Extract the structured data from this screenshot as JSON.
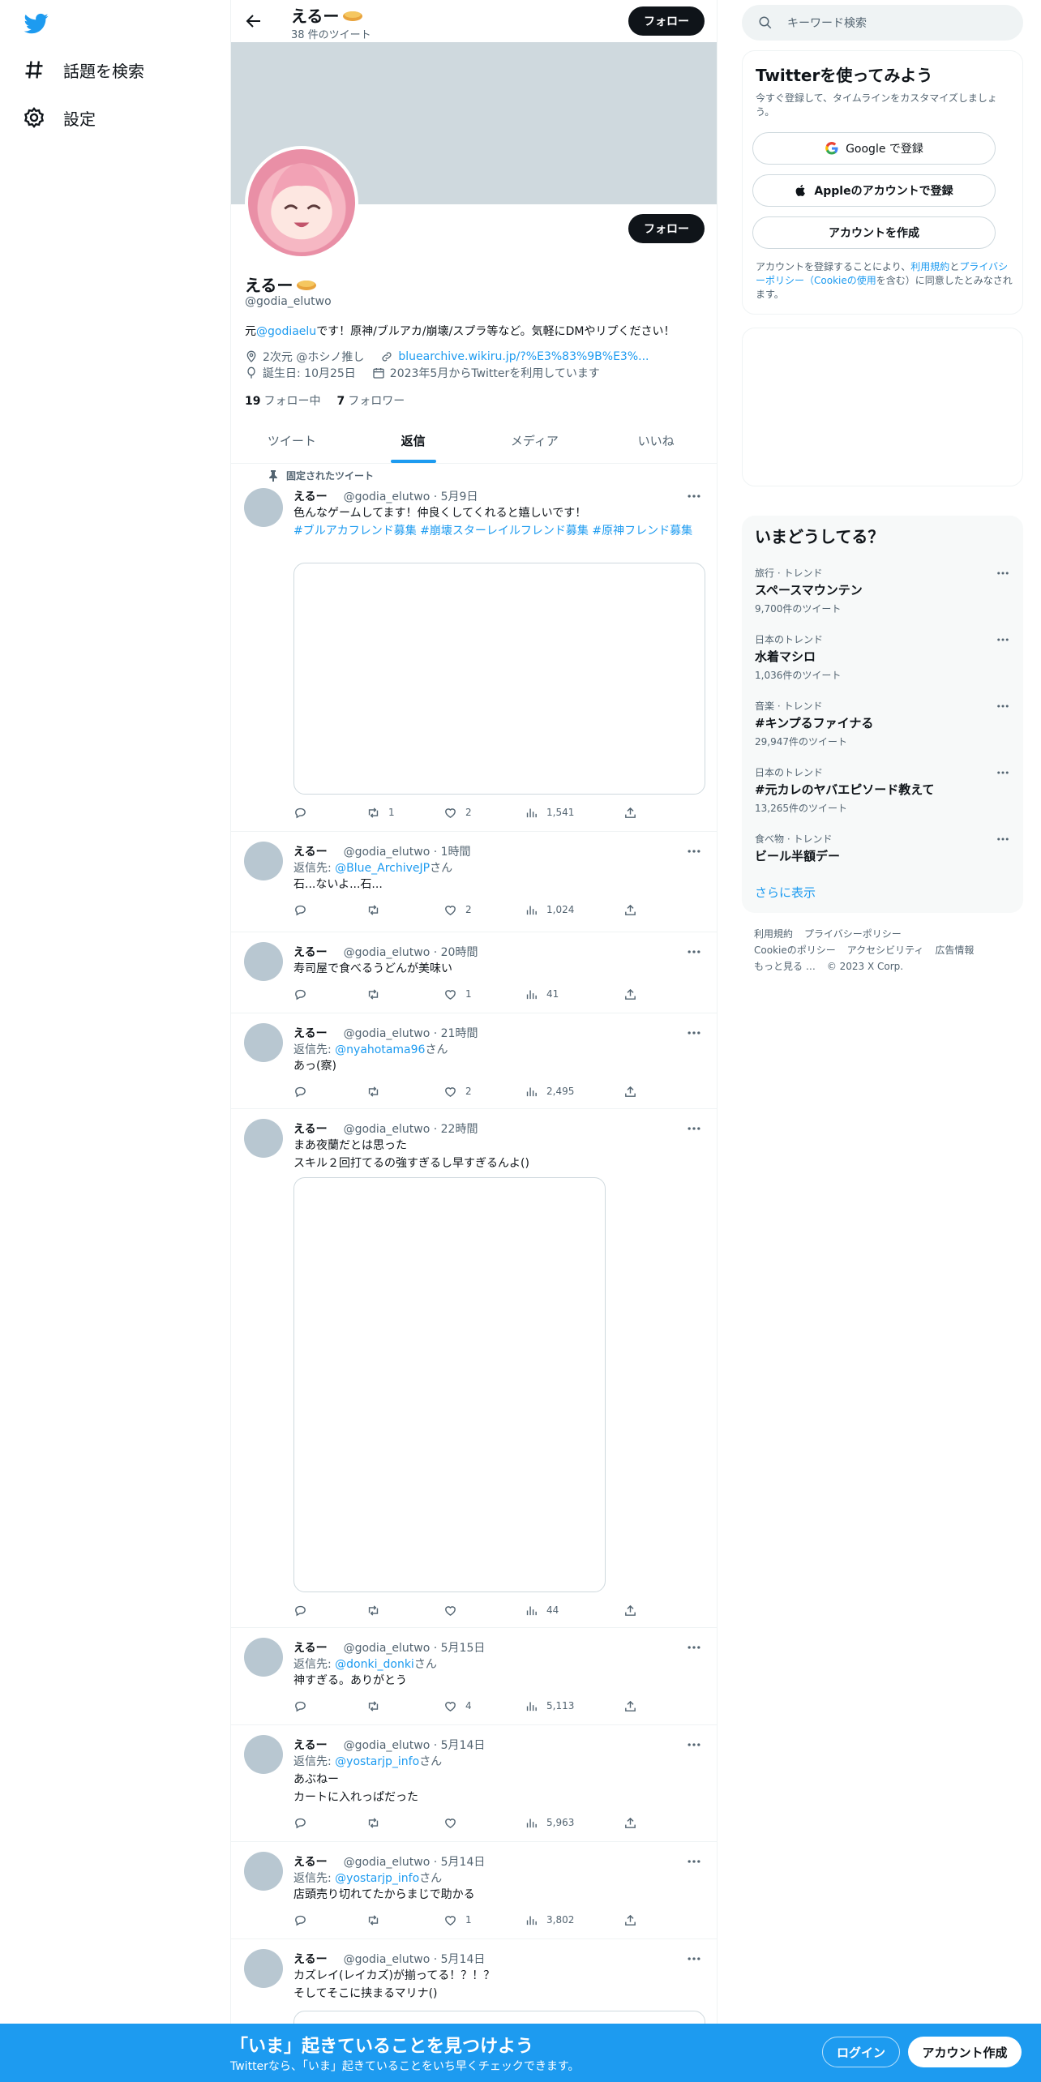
{
  "nav": {
    "explore_label": "話題を検索",
    "settings_label": "設定"
  },
  "header": {
    "name": "えるー",
    "tweet_count": "38 件のツイート",
    "follow_label": "フォロー"
  },
  "profile": {
    "name": "えるー",
    "handle": "@godia_elutwo",
    "follow_label": "フォロー",
    "bio_prefix": "元",
    "bio_mention": "@godiaelu",
    "bio_suffix": "です！原神/ブルアカ/崩壊/スプラ等など。気軽にDMやリプください！",
    "location": "2次元 @ホシノ推し",
    "website": "bluearchive.wikiru.jp/?%E3%83%9B%E3%...",
    "birthday": "誕生日: 10月25日",
    "joined": "2023年5月からTwitterを利用しています",
    "following_count": "19",
    "following_label": "フォロー中",
    "followers_count": "7",
    "followers_label": "フォロワー"
  },
  "tabs": [
    "ツイート",
    "返信",
    "メディア",
    "いいね"
  ],
  "pinned_label": "固定されたツイート",
  "reply_suffix": "さん",
  "reply_prefix": "返信先: ",
  "tweets": [
    {
      "name": "えるー",
      "meta": "@godia_elutwo · 5月9日",
      "text": "色んなゲームしてます！仲良くしてくれると嬉しいです！",
      "hashtags": "#ブルアカフレンド募集 #崩壊スターレイルフレンド募集 #原神フレンド募集",
      "reply": "",
      "stats": [
        "",
        "1",
        "2",
        "1,541"
      ]
    },
    {
      "name": "えるー",
      "meta": "@godia_elutwo · 1時間",
      "reply": "@Blue_ArchiveJP",
      "text": "石...ないよ...石...",
      "stats": [
        "",
        "",
        "2",
        "1,024"
      ]
    },
    {
      "name": "えるー",
      "meta": "@godia_elutwo · 20時間",
      "reply": "",
      "text": "寿司屋で食べるうどんが美味い",
      "stats": [
        "",
        "",
        "1",
        "41"
      ]
    },
    {
      "name": "えるー",
      "meta": "@godia_elutwo · 21時間",
      "reply": "@nyahotama96",
      "text": "あっ(察)",
      "stats": [
        "",
        "",
        "2",
        "2,495"
      ]
    },
    {
      "name": "えるー",
      "meta": "@godia_elutwo · 22時間",
      "reply": "",
      "text": "まあ夜蘭だとは思った\nスキル２回打てるの強すぎるし早すぎるんよ()",
      "stats": [
        "",
        "",
        "",
        "44"
      ]
    },
    {
      "name": "えるー",
      "meta": "@godia_elutwo · 5月15日",
      "reply": "@donki_donki",
      "text": "神すぎる。ありがとう",
      "stats": [
        "",
        "",
        "4",
        "5,113"
      ]
    },
    {
      "name": "えるー",
      "meta": "@godia_elutwo · 5月14日",
      "reply": "@yostarjp_info",
      "text": "あぶねー\nカートに入れっぱだった",
      "stats": [
        "",
        "",
        "",
        "5,963"
      ]
    },
    {
      "name": "えるー",
      "meta": "@godia_elutwo · 5月14日",
      "reply": "@yostarjp_info",
      "text": "店頭売り切れてたからまじで助かる",
      "stats": [
        "",
        "",
        "1",
        "3,802"
      ]
    },
    {
      "name": "えるー",
      "meta": "@godia_elutwo · 5月14日",
      "reply": "",
      "text": "カズレイ(レイカズ)が揃ってる！？！？\nそしてそこに挟まるマリナ()",
      "stats": []
    }
  ],
  "search": {
    "placeholder": "キーワード検索"
  },
  "signup": {
    "title": "Twitterを使ってみよう",
    "subtitle": "今すぐ登録して、タイムラインをカスタマイズしましょう。",
    "google": "Google で登録",
    "apple": "Appleのアカウントで登録",
    "create": "アカウントを作成",
    "terms_1": "アカウントを登録することにより、",
    "terms_link1": "利用規約",
    "terms_2": "と",
    "terms_link2": "プライバシーポリシー（Cookieの使用",
    "terms_3": "を含む）に同意したとみなされます。"
  },
  "trends": {
    "title": "いまどうしてる？",
    "items": [
      {
        "category": "旅行 · トレンド",
        "title": "スペースマウンテン",
        "count": "9,700件のツイート"
      },
      {
        "category": "日本のトレンド",
        "title": "水着マシロ",
        "count": "1,036件のツイート"
      },
      {
        "category": "音楽 · トレンド",
        "title": "#キンプるファイナる",
        "count": "29,947件のツイート"
      },
      {
        "category": "日本のトレンド",
        "title": "#元カレのヤバエピソード教えて",
        "count": "13,265件のツイート"
      },
      {
        "category": "食べ物 · トレンド",
        "title": "ビール半額デー",
        "count": ""
      }
    ],
    "show_more": "さらに表示"
  },
  "footer": {
    "links": [
      "利用規約",
      "プライバシーポリシー",
      "Cookieのポリシー",
      "アクセシビリティ",
      "広告情報",
      "もっと見る …",
      "© 2023 X Corp."
    ]
  },
  "bottom_bar": {
    "title": "「いま」起きていることを見つけよう",
    "subtitle": "Twitterなら、「いま」起きていることをいち早くチェックできます。",
    "login": "ログイン",
    "signup": "アカウント作成"
  },
  "colors": {
    "accent": "#1d9bf0",
    "text": "#0f1419",
    "muted": "#536471",
    "banner": "#cfd9de"
  }
}
